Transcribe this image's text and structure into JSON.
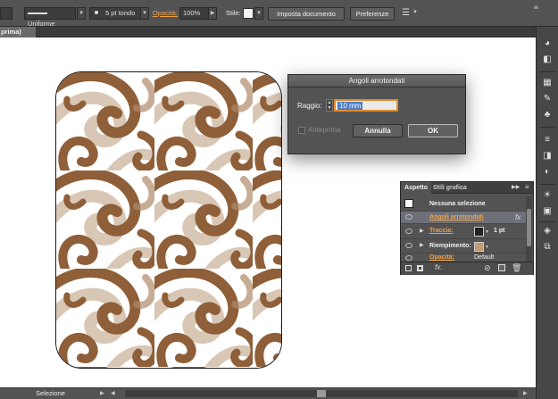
{
  "control_bar": {
    "stroke_style": "Uniforme",
    "brush": "5 pt tondo",
    "opacity_label": "Opacità:",
    "opacity_value": "100%",
    "style_label": "Stile:",
    "document_setup_button": "Imposta documento",
    "preferences_button": "Preferenze"
  },
  "document_tab": {
    "label": "prima)"
  },
  "status_bar": {
    "tool_label": "Selezione"
  },
  "dialog": {
    "title": "Angoli arrotondati",
    "radius_label": "Raggio:",
    "radius_value": "10 mm",
    "preview_label": "Anteprima",
    "cancel_button": "Annulla",
    "ok_button": "OK"
  },
  "appearance_panel": {
    "tabs": [
      "Aspetto",
      "Stili grafica"
    ],
    "header": "Nessuna selezione",
    "effect": "Angoli arrotondati",
    "fx": "fx",
    "stroke_label": "Traccia:",
    "stroke_weight": "1 pt",
    "fill_label": "Riempimento:",
    "opacity_label": "Opacità:",
    "opacity_value": "Default"
  },
  "colors": {
    "ui_gray": "#535353",
    "accent_orange": "#f0a34a",
    "pattern_brown": "#8e5f38",
    "pattern_light": "#d9c7b5"
  }
}
